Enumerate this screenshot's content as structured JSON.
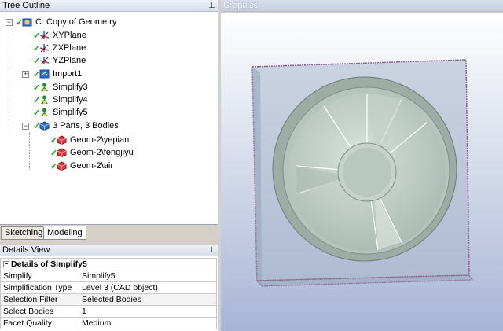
{
  "tree": {
    "title": "Tree Outline",
    "items": [
      {
        "label": "C: Copy of Geometry",
        "icon": "geometry-root-icon"
      },
      {
        "label": "XYPlane",
        "icon": "plane-axes-icon"
      },
      {
        "label": "ZXPlane",
        "icon": "plane-axes-icon"
      },
      {
        "label": "YZPlane",
        "icon": "plane-axes-icon"
      },
      {
        "label": "Import1",
        "icon": "import-icon"
      },
      {
        "label": "Simplify3",
        "icon": "simplify-icon"
      },
      {
        "label": "Simplify4",
        "icon": "simplify-icon"
      },
      {
        "label": "Simplify5",
        "icon": "simplify-icon"
      },
      {
        "label": "3 Parts, 3 Bodies",
        "icon": "parts-icon"
      },
      {
        "label": "Geom-2\\yepian",
        "icon": "body-icon"
      },
      {
        "label": "Geom-2\\fengjiyu",
        "icon": "body-icon"
      },
      {
        "label": "Geom-2\\air",
        "icon": "body-icon"
      }
    ],
    "tabs": [
      "Sketching",
      "Modeling"
    ]
  },
  "details": {
    "title": "Details View",
    "header": "Details of Simplify5",
    "rows": [
      {
        "name": "Simplify",
        "value": "Simplify5"
      },
      {
        "name": "Simplification Type",
        "value": "Level 3 (CAD object)"
      },
      {
        "name": "Selection Filter",
        "value": "Selected Bodies"
      },
      {
        "name": "Select Bodies",
        "value": "1"
      },
      {
        "name": "Facet Quality",
        "value": "Medium"
      }
    ]
  },
  "graphics": {
    "title": "Graphics"
  },
  "colors": {
    "check": "#1aa31a",
    "panel_header": "#d9dfeb",
    "body_icon": "#e0353a",
    "model": "#b9c9c0"
  },
  "pin_glyph": "ᛞ"
}
